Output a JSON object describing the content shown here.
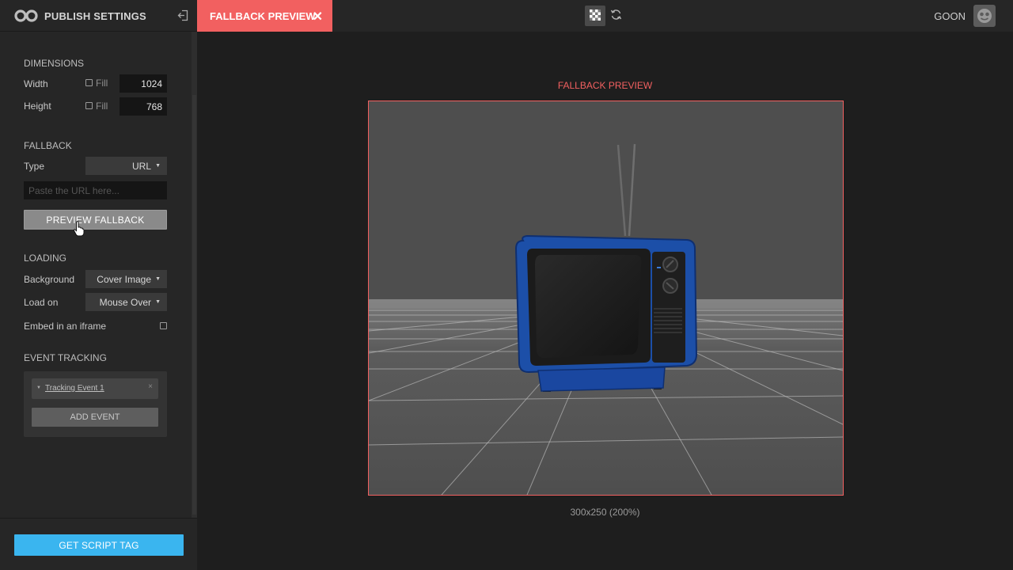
{
  "app": {
    "title": "PUBLISH SETTINGS",
    "logo_icon": "infinity-logo-icon",
    "exit_icon": "exit-icon"
  },
  "tabs": [
    {
      "label": "FALLBACK PREVIEW",
      "active": true,
      "close_icon": "close-icon",
      "close_glyph": "✕"
    }
  ],
  "toolbar": {
    "checkerboard_icon": "checkerboard-icon",
    "refresh_icon": "refresh-icon"
  },
  "user": {
    "name": "GOON",
    "avatar_icon": "avatar-icon"
  },
  "sidebar": {
    "dimensions": {
      "title": "DIMENSIONS",
      "width_label": "Width",
      "height_label": "Height",
      "fill_label": "Fill",
      "width_value": "1024",
      "height_value": "768",
      "width_fill_checked": false,
      "height_fill_checked": false
    },
    "fallback": {
      "title": "FALLBACK",
      "type_label": "Type",
      "type_value": "URL",
      "url_placeholder": "Paste the URL here...",
      "url_value": "",
      "preview_button": "PREVIEW FALLBACK"
    },
    "loading": {
      "title": "LOADING",
      "background_label": "Background",
      "background_value": "Cover Image",
      "load_on_label": "Load on",
      "load_on_value": "Mouse Over",
      "iframe_label": "Embed in an iframe",
      "iframe_checked": false
    },
    "events": {
      "title": "EVENT TRACKING",
      "items": [
        {
          "label": "Tracking Event 1",
          "remove_glyph": "×"
        }
      ],
      "add_button": "ADD EVENT"
    },
    "footer": {
      "script_button": "GET SCRIPT TAG"
    }
  },
  "main": {
    "preview_title": "FALLBACK PREVIEW",
    "preview_size": "300x250 (200%)"
  },
  "colors": {
    "accent": "#f26060",
    "primary_button": "#3ab5ef",
    "tv_body": "#1c4fa8"
  }
}
